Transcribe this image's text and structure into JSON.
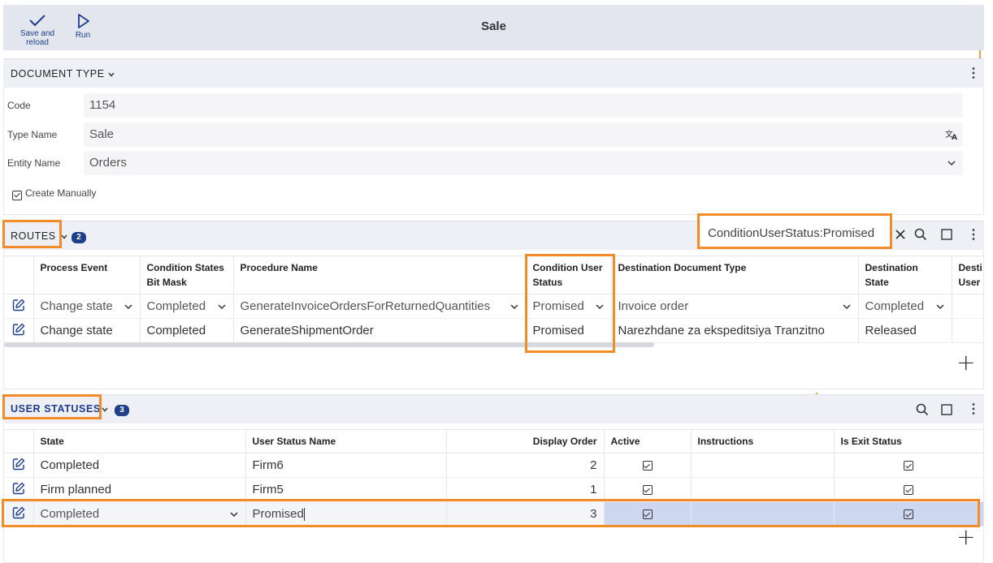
{
  "toolbar": {
    "save_label": "Save and reload",
    "run_label": "Run",
    "title": "Sale"
  },
  "document_type": {
    "header": "DOCUMENT TYPE",
    "fields": {
      "code_label": "Code",
      "code_value": "1154",
      "type_name_label": "Type Name",
      "type_name_value": "Sale",
      "entity_name_label": "Entity Name",
      "entity_name_value": "Orders",
      "create_manually_label": "Create Manually",
      "create_manually_checked": true
    }
  },
  "routes": {
    "header": "ROUTES",
    "count": "2",
    "filter_value": "ConditionUserStatus:Promised",
    "columns": [
      "Process Event",
      "Condition States Bit Mask",
      "Procedure Name",
      "Condition User Status",
      "Destination Document Type",
      "Destination State",
      "Destination User Status"
    ],
    "column_display": [
      "Process Event",
      "Condition States\nBit Mask",
      "Procedure Name",
      "Condition User\nStatus",
      "Destination Document Type",
      "Destination\nState",
      "Desti\nUser"
    ],
    "rows": [
      {
        "process_event": "Change state",
        "condition_states": "Completed",
        "procedure": "GenerateInvoiceOrdersForReturnedQuantities",
        "condition_user_status": "Promised",
        "dest_doc_type": "Invoice order",
        "dest_state": "Completed",
        "editing": true
      },
      {
        "process_event": "Change state",
        "condition_states": "Completed",
        "procedure": "GenerateShipmentOrder",
        "condition_user_status": "Promised",
        "dest_doc_type": "Narezhdane za ekspeditsiya Tranzitno",
        "dest_state": "Released",
        "editing": false
      }
    ]
  },
  "user_statuses": {
    "header": "USER STATUSES",
    "count": "3",
    "columns": [
      "State",
      "User Status Name",
      "Display Order",
      "Active",
      "Instructions",
      "Is Exit Status"
    ],
    "rows": [
      {
        "state": "Completed",
        "name": "Firm6",
        "order": "2",
        "active": true,
        "instructions": "",
        "exit": true,
        "editing": false
      },
      {
        "state": "Firm planned",
        "name": "Firm5",
        "order": "1",
        "active": true,
        "instructions": "",
        "exit": true,
        "editing": false
      },
      {
        "state": "Completed",
        "name": "Promised",
        "order": "3",
        "active": true,
        "instructions": "",
        "exit": true,
        "editing": true
      }
    ]
  },
  "colors": {
    "accent": "#1b3d8c",
    "highlight": "#f28c28",
    "selected_cell": "#cdd8f0",
    "header_bg": "#eef0f6"
  },
  "icons": [
    "check-icon",
    "play-icon",
    "chevron-down-icon",
    "kebab-icon",
    "translate-icon",
    "edit-icon",
    "search-icon",
    "close-icon",
    "expand-icon",
    "plus-icon",
    "checkbox-icon"
  ]
}
